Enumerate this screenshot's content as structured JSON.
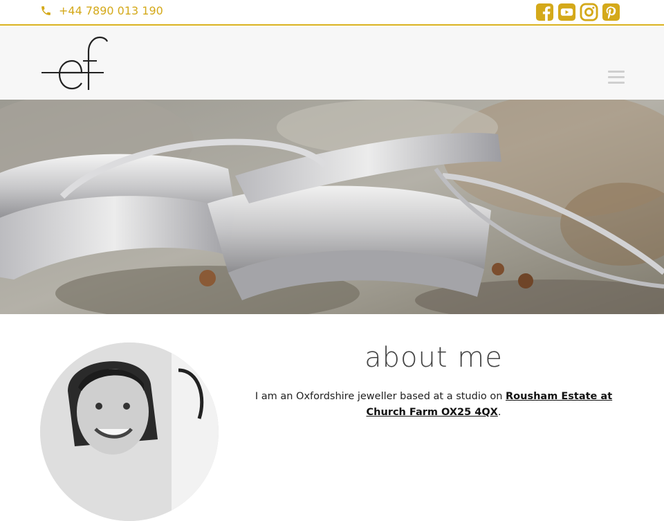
{
  "topbar": {
    "phone": "+44 7890 013 190",
    "phone_icon": "phone-icon",
    "socials": [
      {
        "name": "facebook-icon"
      },
      {
        "name": "youtube-icon"
      },
      {
        "name": "instagram-icon"
      },
      {
        "name": "pinterest-icon"
      }
    ],
    "accent_color": "#d4a91a"
  },
  "navbar": {
    "logo_alt": "ef",
    "menu_icon": "hamburger-menu-icon"
  },
  "hero": {
    "image": "silver-bangles-on-rock-photo"
  },
  "about": {
    "title": "about me",
    "text_prefix": "I am an Oxfordshire jeweller based at a studio on ",
    "link_text": "Rousham Estate at Church Farm OX25 4QX",
    "text_suffix": "."
  }
}
